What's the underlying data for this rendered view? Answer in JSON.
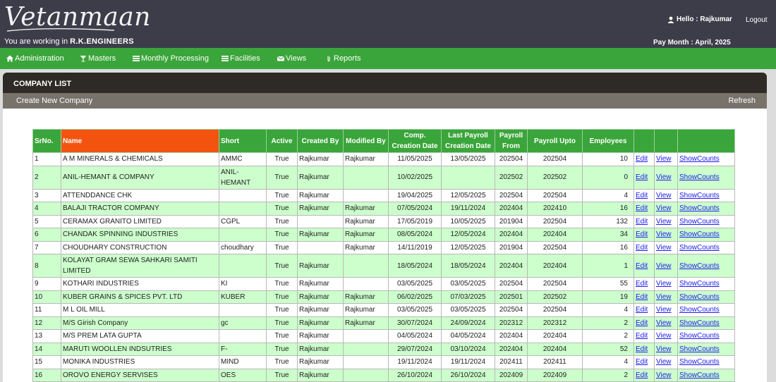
{
  "app": {
    "logo_text": "Vetanmaan",
    "working_prefix": "You are working in",
    "company": "R.K.ENGINEERS",
    "hello": "Hello : Rajkumar",
    "logout": "Logout",
    "pay_month": "Pay Month : April, 2025"
  },
  "nav": {
    "items": [
      {
        "label": "Administration",
        "icon": "home-icon"
      },
      {
        "label": "Masters",
        "icon": "cocktail-icon"
      },
      {
        "label": "Monthly Processing",
        "icon": "list-icon"
      },
      {
        "label": "Facilities",
        "icon": "list-icon"
      },
      {
        "label": "Views",
        "icon": "envelope-icon"
      },
      {
        "label": "Reports",
        "icon": "paperclip-icon"
      }
    ]
  },
  "panel": {
    "title": "COMPANY LIST",
    "create": "Create New Company",
    "refresh": "Refresh"
  },
  "table": {
    "headers": [
      "SrNo.",
      "Name",
      "Short",
      "Active",
      "Created By",
      "Modified By",
      "Comp. Creation Date",
      "Last Payroll Creation Date",
      "Payroll From",
      "Payroll Upto",
      "Employees"
    ],
    "link_labels": {
      "edit": "Edit",
      "view": "View",
      "counts": "ShowCounts"
    },
    "rows": [
      {
        "sr": "1",
        "name": "A M MINERALS & CHEMICALS",
        "short": "AMMC",
        "active": "True",
        "created_by": "Rajkumar",
        "modified_by": "Rajkumar",
        "comp_date": "11/05/2025",
        "last_payroll": "13/05/2025",
        "from": "202504",
        "upto": "202504",
        "employees": "10"
      },
      {
        "sr": "2",
        "name": "ANIL-HEMANT & COMPANY",
        "short": "ANIL-HEMANT",
        "active": "True",
        "created_by": "Rajkumar",
        "modified_by": "",
        "comp_date": "10/02/2025",
        "last_payroll": "",
        "from": "202502",
        "upto": "202502",
        "employees": "0"
      },
      {
        "sr": "3",
        "name": "ATTENDDANCE CHK",
        "short": "",
        "active": "True",
        "created_by": "Rajkumar",
        "modified_by": "",
        "comp_date": "19/04/2025",
        "last_payroll": "12/05/2025",
        "from": "202504",
        "upto": "202504",
        "employees": "4"
      },
      {
        "sr": "4",
        "name": "BALAJI TRACTOR COMPANY",
        "short": "",
        "active": "True",
        "created_by": "Rajkumar",
        "modified_by": "Rajkumar",
        "comp_date": "07/05/2024",
        "last_payroll": "19/11/2024",
        "from": "202404",
        "upto": "202410",
        "employees": "16"
      },
      {
        "sr": "5",
        "name": "CERAMAX GRANITO LIMITED",
        "short": "CGPL",
        "active": "True",
        "created_by": "",
        "modified_by": "Rajkumar",
        "comp_date": "17/05/2019",
        "last_payroll": "10/05/2025",
        "from": "201904",
        "upto": "202504",
        "employees": "132"
      },
      {
        "sr": "6",
        "name": "CHANDAK SPINNING INDUSTRIES",
        "short": "",
        "active": "True",
        "created_by": "Rajkumar",
        "modified_by": "Rajkumar",
        "comp_date": "08/05/2024",
        "last_payroll": "12/05/2024",
        "from": "202404",
        "upto": "202404",
        "employees": "34"
      },
      {
        "sr": "7",
        "name": "CHOUDHARY CONSTRUCTION",
        "short": "choudhary",
        "active": "True",
        "created_by": "",
        "modified_by": "Rajkumar",
        "comp_date": "14/11/2019",
        "last_payroll": "12/05/2025",
        "from": "201904",
        "upto": "202504",
        "employees": "16"
      },
      {
        "sr": "8",
        "name": "KOLAYAT GRAM SEWA SAHKARI SAMITI LIMITED",
        "short": "",
        "active": "True",
        "created_by": "Rajkumar",
        "modified_by": "",
        "comp_date": "18/05/2024",
        "last_payroll": "18/05/2024",
        "from": "202404",
        "upto": "202404",
        "employees": "1"
      },
      {
        "sr": "9",
        "name": "KOTHARI INDUSTRIES",
        "short": "KI",
        "active": "True",
        "created_by": "Rajkumar",
        "modified_by": "",
        "comp_date": "03/05/2025",
        "last_payroll": "03/05/2025",
        "from": "202504",
        "upto": "202504",
        "employees": "55"
      },
      {
        "sr": "10",
        "name": "KUBER GRAINS & SPICES PVT. LTD",
        "short": "KUBER",
        "active": "True",
        "created_by": "Rajkumar",
        "modified_by": "Rajkumar",
        "comp_date": "06/02/2025",
        "last_payroll": "07/03/2025",
        "from": "202501",
        "upto": "202502",
        "employees": "19"
      },
      {
        "sr": "11",
        "name": "M L OIL MILL",
        "short": "",
        "active": "True",
        "created_by": "Rajkumar",
        "modified_by": "Rajkumar",
        "comp_date": "03/05/2025",
        "last_payroll": "03/05/2025",
        "from": "202504",
        "upto": "202504",
        "employees": "4"
      },
      {
        "sr": "12",
        "name": "M/S Girish Company",
        "short": "gc",
        "active": "True",
        "created_by": "Rajkumar",
        "modified_by": "Rajkumar",
        "comp_date": "30/07/2024",
        "last_payroll": "24/09/2024",
        "from": "202312",
        "upto": "202312",
        "employees": "2"
      },
      {
        "sr": "13",
        "name": "M/S PREM LATA GUPTA",
        "short": "",
        "active": "True",
        "created_by": "Rajkumar",
        "modified_by": "",
        "comp_date": "04/05/2024",
        "last_payroll": "04/05/2024",
        "from": "202404",
        "upto": "202404",
        "employees": "2"
      },
      {
        "sr": "14",
        "name": "MARUTI WOOLLEN INDSUTRIES",
        "short": "F-",
        "active": "True",
        "created_by": "Rajkumar",
        "modified_by": "",
        "comp_date": "29/07/2024",
        "last_payroll": "03/10/2024",
        "from": "202404",
        "upto": "202404",
        "employees": "52"
      },
      {
        "sr": "15",
        "name": "MONIKA INDUSTRIES",
        "short": "MIND",
        "active": "True",
        "created_by": "Rajkumar",
        "modified_by": "",
        "comp_date": "19/11/2024",
        "last_payroll": "19/11/2024",
        "from": "202411",
        "upto": "202411",
        "employees": "4"
      },
      {
        "sr": "16",
        "name": "OROVO ENERGY SERVISES",
        "short": "OES",
        "active": "True",
        "created_by": "Rajkumar",
        "modified_by": "",
        "comp_date": "26/10/2024",
        "last_payroll": "26/10/2024",
        "from": "202409",
        "upto": "202409",
        "employees": "2"
      }
    ]
  },
  "colors": {
    "header_dark": "#3d3d4a",
    "nav_green": "#3aa53a",
    "name_header_orange": "#f2540f",
    "row_alt_green": "#ccffcc",
    "link_blue": "#1a1aee"
  }
}
